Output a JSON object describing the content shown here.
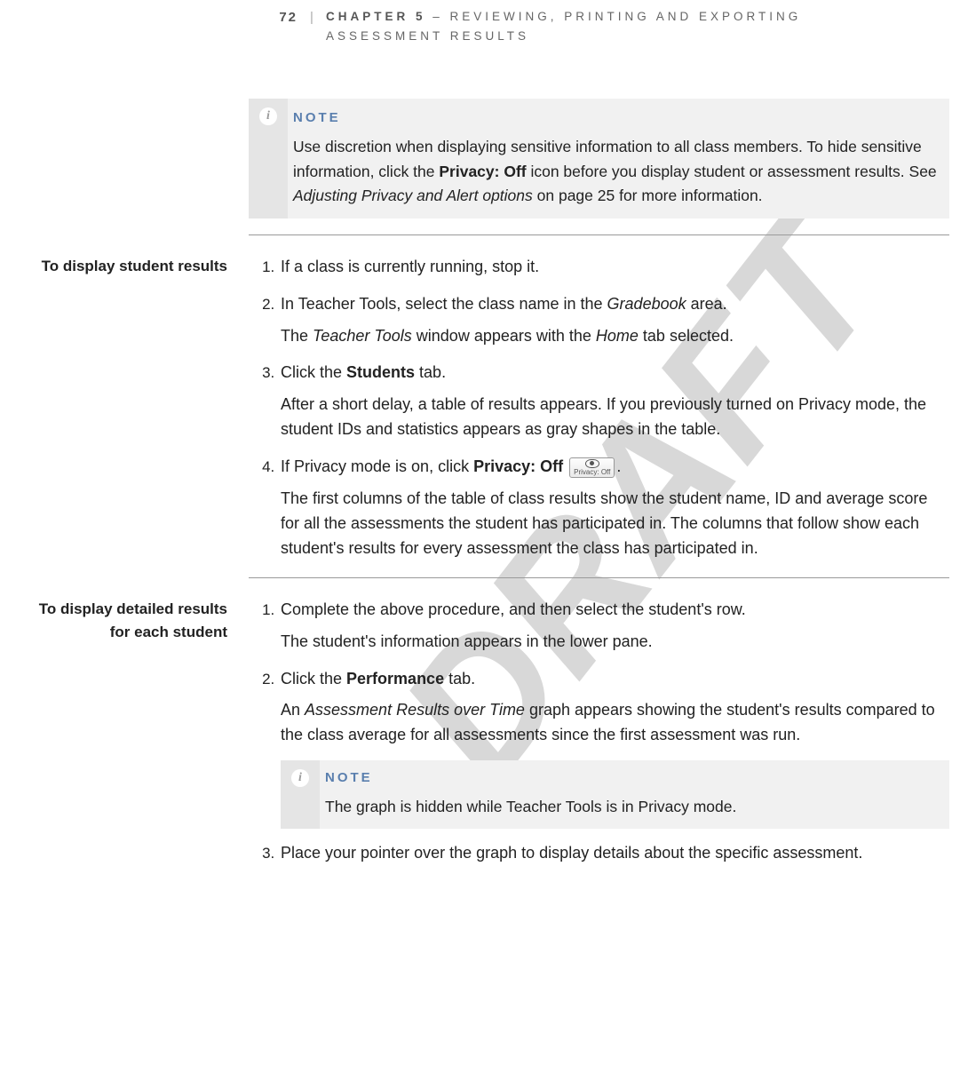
{
  "watermark": "DRAFT",
  "header": {
    "page_number": "72",
    "separator": "|",
    "chapter_bold": "CHAPTER 5",
    "chapter_rest": " – REVIEWING, PRINTING AND EXPORTING ASSESSMENT RESULTS"
  },
  "note1": {
    "heading": "NOTE",
    "text_prefix": "Use discretion when displaying sensitive information to all class members. To hide sensitive information, click the ",
    "bold1": "Privacy: Off",
    "text_mid": " icon before you display student or assessment results. See ",
    "ital1": "Adjusting Privacy and Alert options",
    "text_suffix": " on page 25 for more information."
  },
  "section1": {
    "side_title": "To display student results",
    "steps": {
      "s1": "If a class is currently running, stop it.",
      "s2_pre": "In Teacher Tools, select the class name in the ",
      "s2_ital": "Gradebook",
      "s2_post": " area.",
      "s2_sub_pre": "The ",
      "s2_sub_ital1": "Teacher Tools",
      "s2_sub_mid": " window appears with the ",
      "s2_sub_ital2": "Home",
      "s2_sub_post": " tab selected.",
      "s3_pre": "Click the ",
      "s3_bold": "Students",
      "s3_post": " tab.",
      "s3_sub": "After a short delay, a table of results appears. If you previously turned on Privacy mode, the student IDs and statistics appears as gray shapes in the table.",
      "s4_pre": "If Privacy mode is on, click ",
      "s4_bold": "Privacy: Off",
      "s4_icon_label": "Privacy: Off",
      "s4_post": ".",
      "s4_sub": "The first columns of the table of class results show the student name, ID and average score for all the assessments the student has participated in. The columns that follow show each student's results for every assessment the class has participated in."
    }
  },
  "section2": {
    "side_title_line1": "To display detailed results",
    "side_title_line2": "for each student",
    "steps": {
      "s1": "Complete the above procedure, and then select the student's row.",
      "s1_sub": "The student's information appears in the lower pane.",
      "s2_pre": "Click the ",
      "s2_bold": "Performance",
      "s2_post": " tab.",
      "s2_sub_pre": "An ",
      "s2_sub_ital": "Assessment Results over Time",
      "s2_sub_post": " graph appears showing the student's results compared to the class average for all assessments since the first assessment was run.",
      "s3": "Place your pointer over the graph to display details about the specific assessment."
    },
    "note2": {
      "heading": "NOTE",
      "text": "The graph is hidden while Teacher Tools is in Privacy mode."
    }
  }
}
